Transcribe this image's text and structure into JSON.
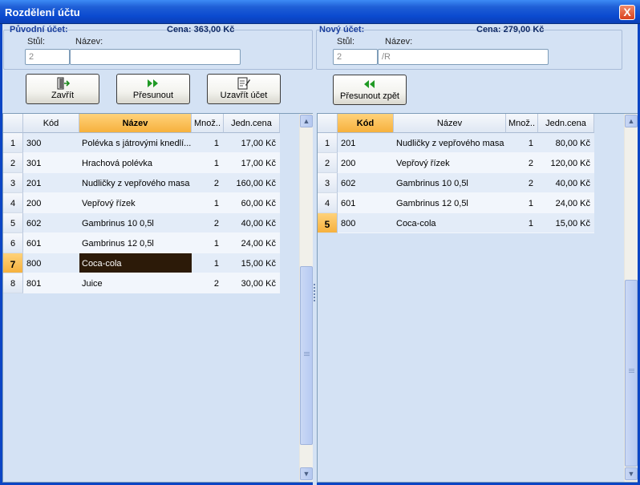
{
  "window": {
    "title": "Rozdělení účtu",
    "close_label": "X"
  },
  "original": {
    "group_label": "Původní účet:",
    "price": "Cena: 363,00 Kč",
    "table_label": "Stůl:",
    "name_label": "Název:",
    "table_value": "2",
    "name_value": ""
  },
  "new": {
    "group_label": "Nový účet:",
    "price": "Cena: 279,00 Kč",
    "table_label": "Stůl:",
    "name_label": "Název:",
    "table_value": "2",
    "name_value": "/R"
  },
  "buttons": {
    "close": "Zavřít",
    "move": "Přesunout",
    "close_bill": "Uzavřít účet",
    "move_back": "Přesunout zpět"
  },
  "left_grid": {
    "headers": [
      "Kód",
      "Název",
      "Množ..",
      "Jedn.cena"
    ],
    "rows": [
      {
        "n": "1",
        "code": "300",
        "name": "Polévka s játrovými knedlí...",
        "qty": "1",
        "price": "17,00 Kč"
      },
      {
        "n": "2",
        "code": "301",
        "name": "Hrachová polévka",
        "qty": "1",
        "price": "17,00 Kč"
      },
      {
        "n": "3",
        "code": "201",
        "name": "Nudličky z vepřového masa",
        "qty": "2",
        "price": "160,00 Kč"
      },
      {
        "n": "4",
        "code": "200",
        "name": "Vepřový řízek",
        "qty": "1",
        "price": "60,00 Kč"
      },
      {
        "n": "5",
        "code": "602",
        "name": "Gambrinus 10 0,5l",
        "qty": "2",
        "price": "40,00 Kč"
      },
      {
        "n": "6",
        "code": "601",
        "name": "Gambrinus 12 0,5l",
        "qty": "1",
        "price": "24,00 Kč"
      },
      {
        "n": "7",
        "code": "800",
        "name": "Coca-cola",
        "qty": "1",
        "price": "15,00 Kč"
      },
      {
        "n": "8",
        "code": "801",
        "name": "Juice",
        "qty": "2",
        "price": "30,00 Kč"
      }
    ]
  },
  "right_grid": {
    "headers": [
      "Kód",
      "Název",
      "Množ..",
      "Jedn.cena"
    ],
    "rows": [
      {
        "n": "1",
        "code": "201",
        "name": "Nudličky z vepřového masa",
        "qty": "1",
        "price": "80,00 Kč"
      },
      {
        "n": "2",
        "code": "200",
        "name": "Vepřový řízek",
        "qty": "2",
        "price": "120,00 Kč"
      },
      {
        "n": "3",
        "code": "602",
        "name": "Gambrinus 10 0,5l",
        "qty": "2",
        "price": "40,00 Kč"
      },
      {
        "n": "4",
        "code": "601",
        "name": "Gambrinus 12 0,5l",
        "qty": "1",
        "price": "24,00 Kč"
      },
      {
        "n": "5",
        "code": "800",
        "name": "Coca-cola",
        "qty": "1",
        "price": "15,00 Kč"
      }
    ]
  },
  "icons": {
    "close": "door-exit-icon",
    "move": "fast-forward-icon",
    "close_bill": "edit-document-icon",
    "move_back": "rewind-icon",
    "scroll_up": "chevron-up-icon",
    "scroll_down": "chevron-down-icon"
  },
  "colors": {
    "titlebar": "#0b4ad0",
    "accent_header": "#f6b13d",
    "selection": "#2c1a08",
    "group_label": "#1a3f9e"
  },
  "selection": {
    "left_row": 7,
    "right_row": 5
  }
}
